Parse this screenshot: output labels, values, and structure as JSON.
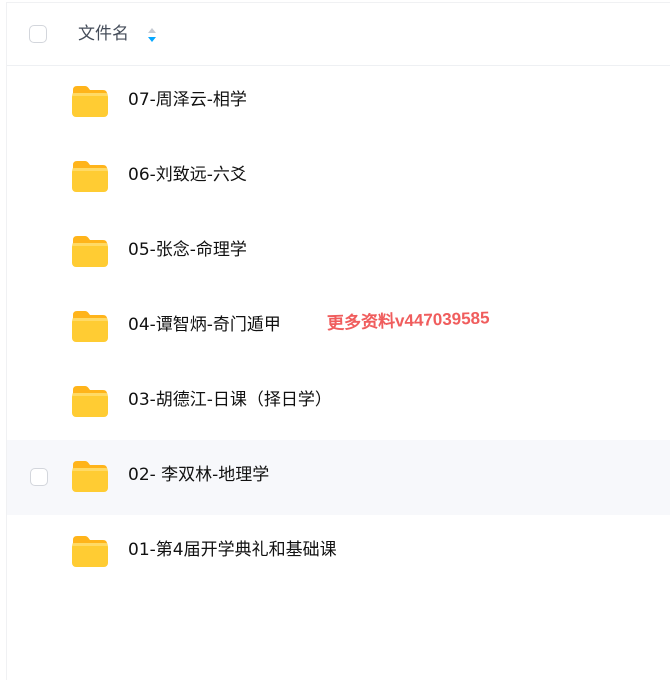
{
  "header": {
    "column_label": "文件名"
  },
  "files": [
    {
      "name": "07-周泽云-相学",
      "icon": "folder-icon"
    },
    {
      "name": "06-刘致远-六爻",
      "icon": "folder-icon"
    },
    {
      "name": "05-张念-命理学",
      "icon": "folder-icon"
    },
    {
      "name": "04-谭智炳-奇门遁甲",
      "icon": "folder-icon"
    },
    {
      "name": "03-胡德江-日课（择日学）",
      "icon": "folder-icon"
    },
    {
      "name": "02- 李双林-地理学",
      "icon": "folder-icon",
      "hovered": true
    },
    {
      "name": "01-第4届开学典礼和基础课",
      "icon": "folder-icon"
    }
  ],
  "watermark": "更多资料v447039585",
  "colors": {
    "folder": "#ffc629",
    "folder_tab": "#ffb41a",
    "sort_down": "#06a7ff",
    "sort_up": "#c4cad3",
    "hover_row": "#f7f8fb",
    "watermark": "#f05d5d"
  }
}
